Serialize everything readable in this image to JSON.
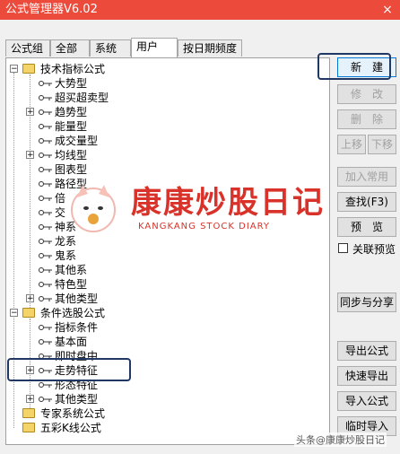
{
  "window": {
    "title": "公式管理器V6.02",
    "close_label": "×"
  },
  "tabs": [
    {
      "label": "公式组"
    },
    {
      "label": "全部"
    },
    {
      "label": "系统"
    },
    {
      "label": "用户"
    },
    {
      "label": "按日期频度"
    }
  ],
  "tree": {
    "root1": "技术指标公式",
    "root1_children": [
      "大势型",
      "超买超卖型",
      "趋势型",
      "能量型",
      "成交量型",
      "均线型",
      "图表型",
      "路径型",
      "倍",
      "交",
      "神系",
      "龙系",
      "鬼系",
      "其他系",
      "特色型",
      "其他类型"
    ],
    "root2": "条件选股公式",
    "root2_children": [
      "指标条件",
      "基本面",
      "即时盘中",
      "走势特征",
      "形态特征",
      "其他类型"
    ],
    "root3": "专家系统公式",
    "root4": "五彩K线公式"
  },
  "buttons": {
    "new": "新　建",
    "modify": "修　改",
    "delete": "删　除",
    "move_up": "上移",
    "move_down": "下移",
    "add_common": "加入常用",
    "find": "查找(F3)",
    "preview": "预　览",
    "sync_share": "同步与分享",
    "export": "导出公式",
    "quick_export": "快速导出",
    "import": "导入公式",
    "temp_import": "临时导入"
  },
  "checkbox": {
    "label": "关联预览"
  },
  "watermark": {
    "brand": "康康炒股日记",
    "sub": "KANGKANG STOCK DIARY"
  },
  "credit": "头条@康康炒股日记"
}
